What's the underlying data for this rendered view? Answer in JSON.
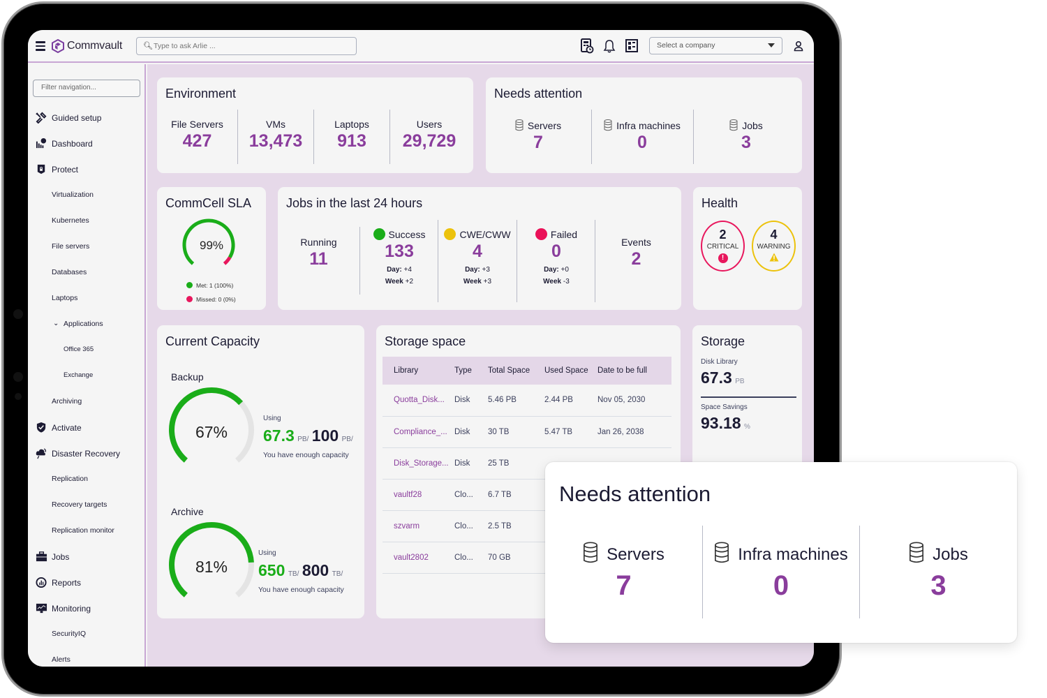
{
  "topbar": {
    "brand": "Commvault",
    "search_placeholder": "Type to ask Arlie ...",
    "company_select": "Select a company",
    "icons": [
      "calculator-clock-icon",
      "bell-icon",
      "dashboard-grid-icon",
      "user-icon"
    ]
  },
  "sidebar": {
    "filter_placeholder": "Filter navigation...",
    "items": [
      {
        "label": "Guided setup",
        "icon": "tools-icon",
        "level": 0
      },
      {
        "label": "Dashboard",
        "icon": "chart-icon",
        "level": 0
      },
      {
        "label": "Protect",
        "icon": "shield-lock-icon",
        "level": 0
      },
      {
        "label": "Virtualization",
        "level": 1
      },
      {
        "label": "Kubernetes",
        "level": 1
      },
      {
        "label": "File servers",
        "level": 1
      },
      {
        "label": "Databases",
        "level": 1
      },
      {
        "label": "Laptops",
        "level": 1
      },
      {
        "label": "Applications",
        "level": 1,
        "expanded": true
      },
      {
        "label": "Office 365",
        "level": 2
      },
      {
        "label": "Exchange",
        "level": 2
      },
      {
        "label": "Archiving",
        "level": 1
      },
      {
        "label": "Activate",
        "icon": "shield-check-icon",
        "level": 0
      },
      {
        "label": "Disaster Recovery",
        "icon": "cloud-recovery-icon",
        "level": 0
      },
      {
        "label": "Replication",
        "level": 1
      },
      {
        "label": "Recovery targets",
        "level": 1
      },
      {
        "label": "Replication monitor",
        "level": 1
      },
      {
        "label": "Jobs",
        "icon": "briefcase-icon",
        "level": 0
      },
      {
        "label": "Reports",
        "icon": "report-icon",
        "level": 0
      },
      {
        "label": "Monitoring",
        "icon": "monitor-icon",
        "level": 0
      },
      {
        "label": "SecurityIQ",
        "level": 1
      },
      {
        "label": "Alerts",
        "level": 1
      }
    ]
  },
  "environment": {
    "title": "Environment",
    "stats": [
      {
        "label": "File Servers",
        "value": "427"
      },
      {
        "label": "VMs",
        "value": "13,473"
      },
      {
        "label": "Laptops",
        "value": "913"
      },
      {
        "label": "Users",
        "value": "29,729"
      }
    ]
  },
  "needs_attention": {
    "title": "Needs attention",
    "stats": [
      {
        "label": "Servers",
        "value": "7"
      },
      {
        "label": "Infra machines",
        "value": "0"
      },
      {
        "label": "Jobs",
        "value": "3"
      }
    ]
  },
  "sla": {
    "title": "CommCell SLA",
    "percent_label": "99%",
    "percent": 99,
    "legend": [
      {
        "label": "Met: 1 (100%)",
        "color": "#1aad19"
      },
      {
        "label": "Missed: 0 (0%)",
        "color": "#e8175d"
      }
    ]
  },
  "jobs24": {
    "title": "Jobs in the last 24 hours",
    "columns": [
      {
        "label": "Running",
        "value": "11"
      },
      {
        "label": "Success",
        "value": "133",
        "dot": "#1aad19",
        "day_label": "Day:",
        "day": "+4",
        "week_label": "Week",
        "week": "+2"
      },
      {
        "label": "CWE/CWW",
        "value": "4",
        "dot": "#ecc20c",
        "day_label": "Day:",
        "day": "+3",
        "week_label": "Week",
        "week": "+3"
      },
      {
        "label": "Failed",
        "value": "0",
        "dot": "#ea1158",
        "day_label": "Day:",
        "day": "+0",
        "week_label": "Week",
        "week": "-3"
      },
      {
        "label": "Events",
        "value": "2"
      }
    ]
  },
  "health": {
    "title": "Health",
    "critical": {
      "count": "2",
      "label": "CRITICAL",
      "color": "#e8175d"
    },
    "warning": {
      "count": "4",
      "label": "WARNING",
      "color": "#ecc20c"
    }
  },
  "capacity": {
    "title": "Current Capacity",
    "backup": {
      "title": "Backup",
      "percent": 67,
      "percent_label": "67%",
      "using_label": "Using",
      "used": "67.3",
      "used_unit": "PB/",
      "total": "100",
      "total_unit": "PB/",
      "note": "You have enough capacity"
    },
    "archive": {
      "title": "Archive",
      "percent": 81,
      "percent_label": "81%",
      "using_label": "Using",
      "used": "650",
      "used_unit": "TB/",
      "total": "800",
      "total_unit": "TB/",
      "note": "You have enough capacity"
    }
  },
  "storage_space": {
    "title": "Storage space",
    "headers": [
      "Library",
      "Type",
      "Total Space",
      "Used Space",
      "Date to be full"
    ],
    "rows": [
      [
        "Quotta_Disk...",
        "Disk",
        "5.46 PB",
        "2.44 PB",
        "Nov 05, 2030"
      ],
      [
        "Compliance_...",
        "Disk",
        "30 TB",
        "5.47 TB",
        "Jan 26, 2038"
      ],
      [
        "Disk_Storage...",
        "Disk",
        "25 TB",
        "",
        ""
      ],
      [
        "vaultf28",
        "Clo...",
        "6.7 TB",
        "",
        ""
      ],
      [
        "szvarm",
        "Clo...",
        "2.5 TB",
        "",
        ""
      ],
      [
        "vault2802",
        "Clo...",
        "70 GB",
        "",
        ""
      ]
    ]
  },
  "storage": {
    "title": "Storage",
    "disk_library_label": "Disk Library",
    "disk_library_value": "67.3",
    "disk_library_unit": "PB",
    "savings_label": "Space Savings",
    "savings_value": "93.18",
    "savings_unit": "%"
  },
  "overlay": {
    "title": "Needs attention",
    "stats": [
      {
        "label": "Servers",
        "value": "7"
      },
      {
        "label": "Infra machines",
        "value": "0"
      },
      {
        "label": "Jobs",
        "value": "3"
      }
    ]
  },
  "colors": {
    "accent_purple": "#8a3d9c",
    "success_green": "#1aad19",
    "warning_yellow": "#ecc20c",
    "critical_red": "#e8175d",
    "content_bg": "#e6d9e9"
  }
}
